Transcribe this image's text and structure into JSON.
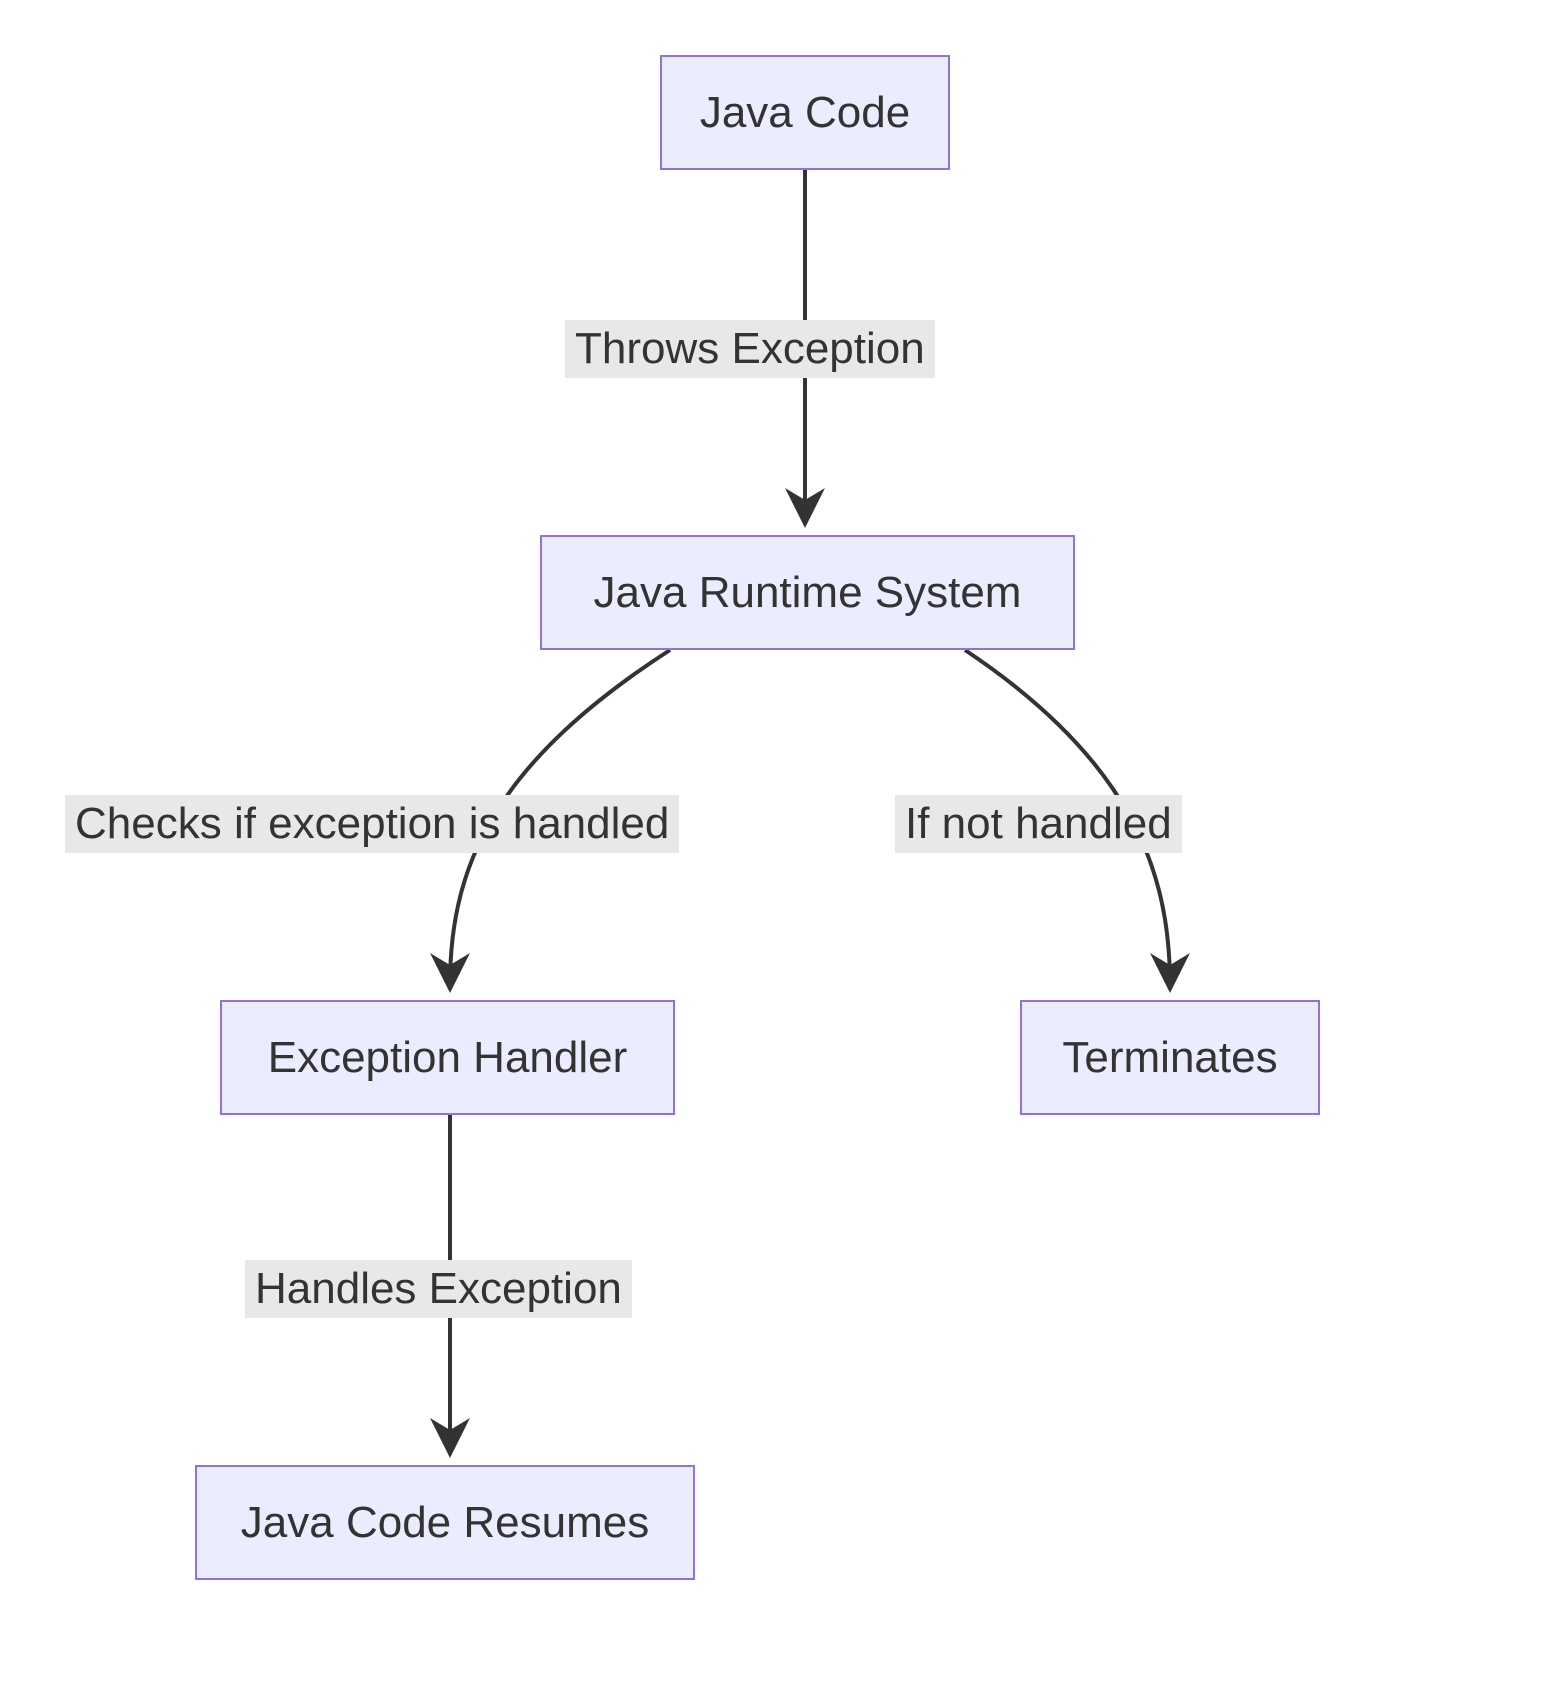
{
  "diagram": {
    "type": "flowchart",
    "direction": "top-down",
    "nodes": {
      "A": {
        "label": "Java Code"
      },
      "B": {
        "label": "Java Runtime System"
      },
      "C": {
        "label": "Exception Handler"
      },
      "D": {
        "label": "Java Code Resumes"
      },
      "E": {
        "label": "Terminates"
      }
    },
    "edges": {
      "A_B": {
        "label": "Throws Exception"
      },
      "B_C": {
        "label": "Checks if exception is handled"
      },
      "B_E": {
        "label": "If not handled"
      },
      "C_D": {
        "label": "Handles Exception"
      }
    },
    "style": {
      "node_fill": "#ECECFF",
      "node_border": "#9370DB",
      "edge_label_bg": "#e8e8e8",
      "stroke": "#333333"
    }
  }
}
